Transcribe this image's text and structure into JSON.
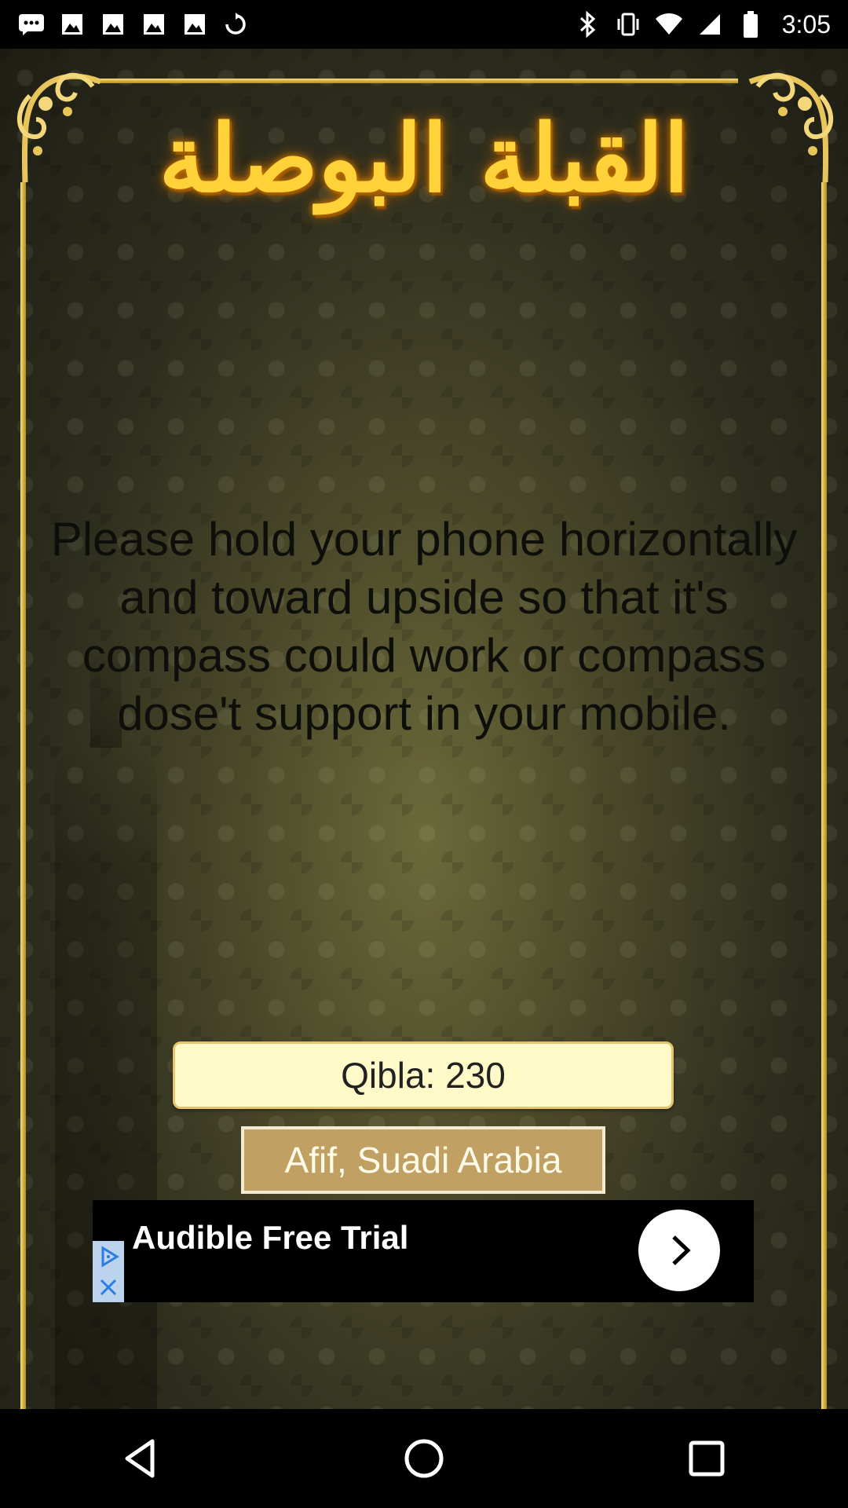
{
  "app": {
    "title_arabic": "القبلة البوصلة",
    "message": "Please hold your phone horizontally and toward upside so that it's compass could work or compass dose't support in your mobile.",
    "qibla_label": "Qibla: 230",
    "location": "Afif, Suadi Arabia"
  },
  "ad": {
    "text": "Audible Free Trial",
    "icons": [
      "adchoices-icon",
      "close-icon",
      "chevron-right-icon"
    ]
  },
  "status_bar": {
    "time": "3:05",
    "left_icons": [
      "message-icon",
      "photo-icon",
      "photo-icon",
      "photo-icon",
      "photo-icon",
      "sync-icon"
    ],
    "right_icons": [
      "bluetooth-icon",
      "vibrate-icon",
      "wifi-icon",
      "signal-icon",
      "battery-icon"
    ]
  },
  "nav": {
    "icons": [
      "back-icon",
      "home-icon",
      "recents-icon"
    ]
  },
  "colors": {
    "title_gold": "#ffd23a",
    "frame_gold": "#d9b447",
    "qibla_bg": "#fffac8",
    "location_bg": "#c1a063"
  }
}
